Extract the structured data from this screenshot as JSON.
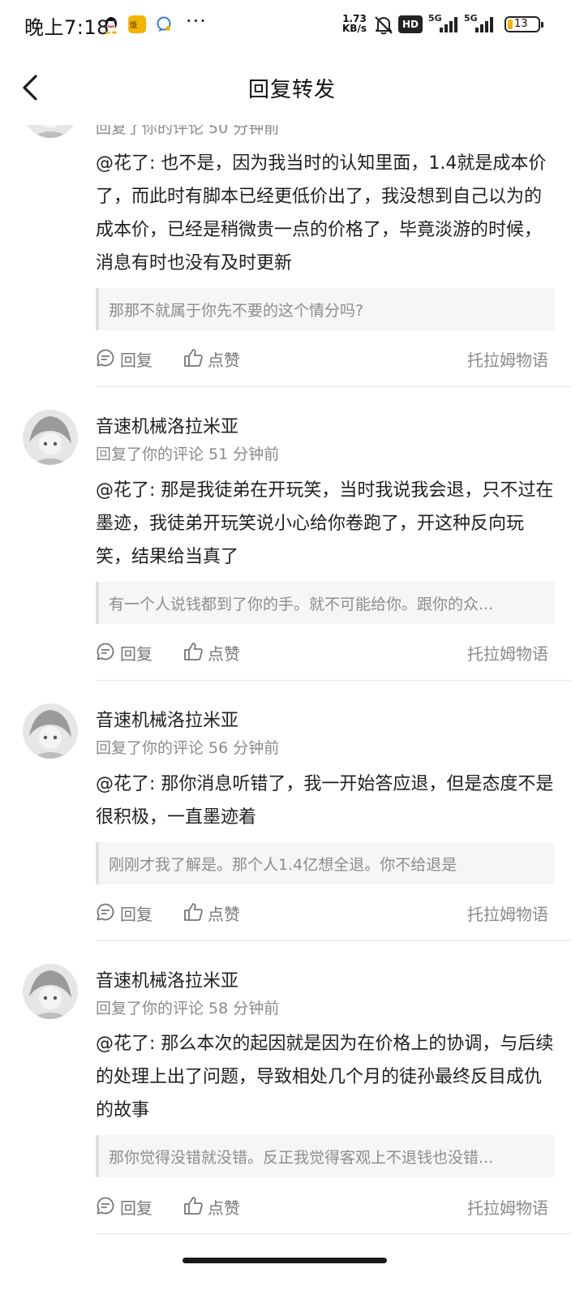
{
  "status_bar": {
    "time": "晚上7:18",
    "app_box_label": "饿",
    "more": "···",
    "speed_value": "1.73",
    "speed_unit": "KB/s",
    "hd": "HD",
    "network_1": "5G",
    "network_2": "5G",
    "battery": "13",
    "battery_color": "#f2b400"
  },
  "header": {
    "title": "回复转发"
  },
  "comments": [
    {
      "author": "",
      "meta": "回复了你的评论 50 分钟前",
      "text": "@花了: 也不是，因为我当时的认知里面，1.4就是成本价了，而此时有脚本已经更低价出了，我没想到自己以为的成本价，已经是稍微贵一点的价格了，毕竟淡游的时候，消息有时也没有及时更新",
      "quote": "那那不就属于你先不要的这个情分吗?",
      "reply_label": "回复",
      "like_label": "点赞",
      "source": "托拉姆物语"
    },
    {
      "author": "音速机械洛拉米亚",
      "meta": "回复了你的评论 51 分钟前",
      "text": "@花了: 那是我徒弟在开玩笑，当时我说我会退，只不过在墨迹，我徒弟开玩笑说小心给你卷跑了，开这种反向玩笑，结果给当真了",
      "quote": "有一个人说钱都到了你的手。就不可能给你。跟你的众...",
      "reply_label": "回复",
      "like_label": "点赞",
      "source": "托拉姆物语"
    },
    {
      "author": "音速机械洛拉米亚",
      "meta": "回复了你的评论 56 分钟前",
      "text": "@花了: 那你消息听错了，我一开始答应退，但是态度不是很积极，一直墨迹着",
      "quote": "刚刚才我了解是。那个人1.4亿想全退。你不给退是",
      "reply_label": "回复",
      "like_label": "点赞",
      "source": "托拉姆物语"
    },
    {
      "author": "音速机械洛拉米亚",
      "meta": "回复了你的评论 58 分钟前",
      "text": "@花了: 那么本次的起因就是因为在价格上的协调，与后续的处理上出了问题，导致相处几个月的徒孙最终反目成仇的故事",
      "quote": "那你觉得没错就没错。反正我觉得客观上不退钱也没错...",
      "reply_label": "回复",
      "like_label": "点赞",
      "source": "托拉姆物语"
    }
  ]
}
